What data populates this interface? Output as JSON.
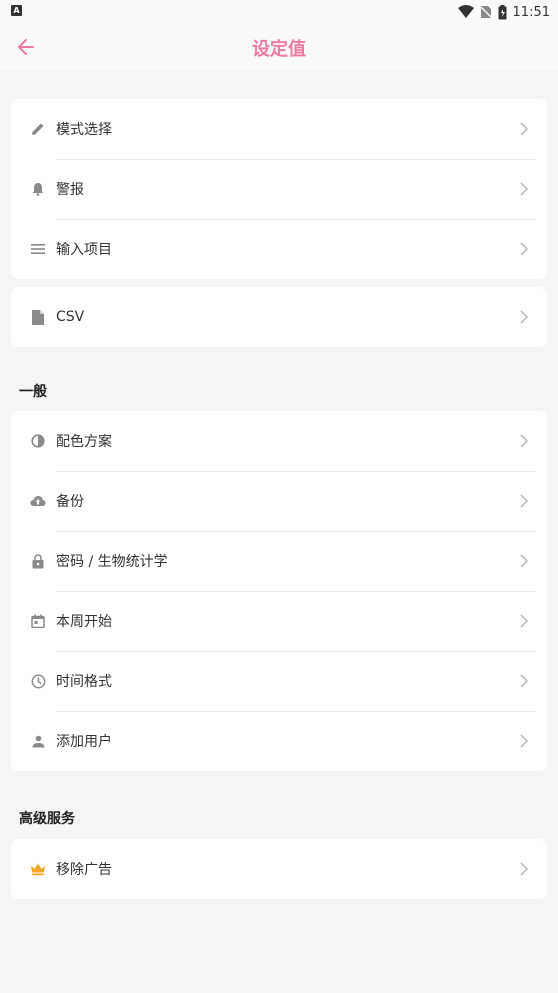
{
  "status": {
    "left_badge": "A",
    "time": "11:51"
  },
  "header": {
    "title": "设定值"
  },
  "group_top": {
    "items": [
      {
        "label": "模式选择"
      },
      {
        "label": "警报"
      },
      {
        "label": "输入项目"
      }
    ]
  },
  "group_csv": {
    "items": [
      {
        "label": "CSV"
      }
    ]
  },
  "general": {
    "title": "一般",
    "items": [
      {
        "label": "配色方案"
      },
      {
        "label": "备份"
      },
      {
        "label": "密码 / 生物统计学"
      },
      {
        "label": "本周开始"
      },
      {
        "label": "时间格式"
      },
      {
        "label": "添加用户"
      }
    ]
  },
  "premium": {
    "title": "高级服务",
    "items": [
      {
        "label": "移除广告"
      }
    ]
  },
  "colors": {
    "accent": "#f17aa4",
    "icon": "#8a8a8a",
    "crown": "#f5a623",
    "chevron": "#b5b5b5"
  }
}
